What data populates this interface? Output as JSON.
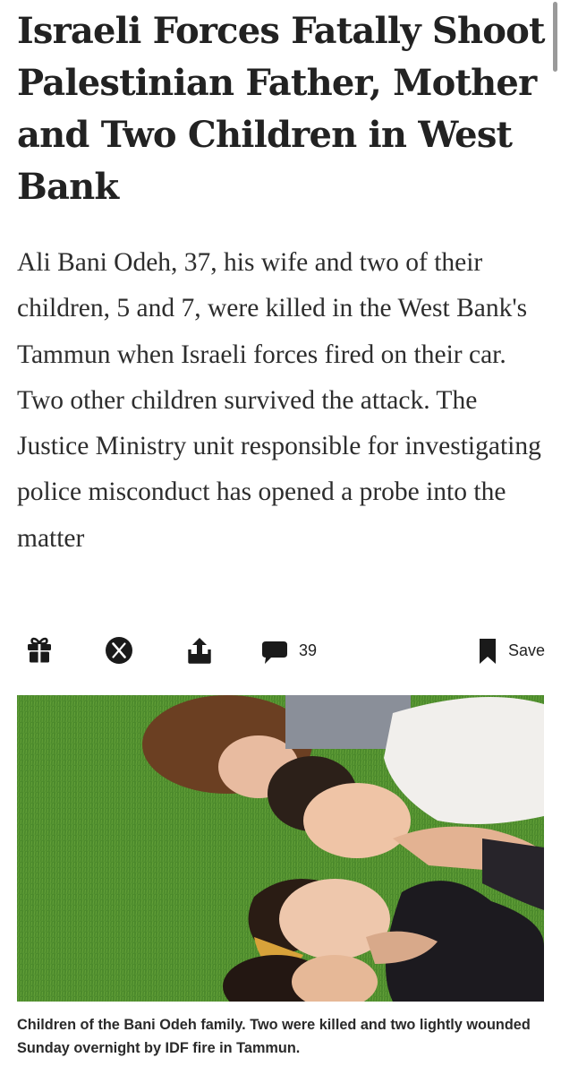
{
  "article": {
    "headline": "Israeli Forces Fatally Shoot Palestinian Father, Mother and Two Children in West Bank",
    "dek": "Ali Bani Odeh, 37, his wife and two of their children, 5 and 7, were killed in the West Bank's Tammun when Israeli forces fired on their car. Two other children survived the attack. The Justice Ministry unit responsible for investigating police misconduct has opened a probe into the matter",
    "caption": "Children of the Bani Odeh family. Two were killed and two lightly wounded Sunday overnight by IDF fire in Tammun."
  },
  "actions": {
    "gift_icon": "gift-icon",
    "x_icon": "x-logo-icon",
    "share_icon": "share-icon",
    "comment_icon": "comment-bubble-icon",
    "comment_count": "39",
    "save_icon": "bookmark-icon",
    "save_label": "Save"
  },
  "colors": {
    "text": "#222222",
    "icon": "#1a1a1a",
    "grass": "#4e8a2c"
  }
}
